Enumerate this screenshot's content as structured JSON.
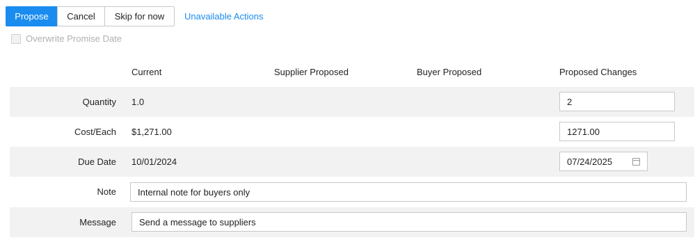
{
  "toolbar": {
    "propose_label": "Propose",
    "cancel_label": "Cancel",
    "skip_label": "Skip for now",
    "unavailable_label": "Unavailable Actions"
  },
  "options": {
    "overwrite_promise_date_label": "Overwrite Promise Date"
  },
  "columns": {
    "current": "Current",
    "supplier_proposed": "Supplier Proposed",
    "buyer_proposed": "Buyer Proposed",
    "proposed_changes": "Proposed Changes"
  },
  "rows": {
    "quantity": {
      "label": "Quantity",
      "current": "1.0",
      "proposed": "2"
    },
    "cost": {
      "label": "Cost/Each",
      "current": "$1,271.00",
      "proposed": "1271.00"
    },
    "due_date": {
      "label": "Due Date",
      "current": "10/01/2024",
      "proposed": "07/24/2025"
    }
  },
  "note": {
    "label": "Note",
    "placeholder": "Internal note for buyers only"
  },
  "message": {
    "label": "Message",
    "placeholder": "Send a message to suppliers"
  },
  "colors": {
    "accent": "#1a8cf0",
    "row_shade": "#f2f2f2"
  }
}
